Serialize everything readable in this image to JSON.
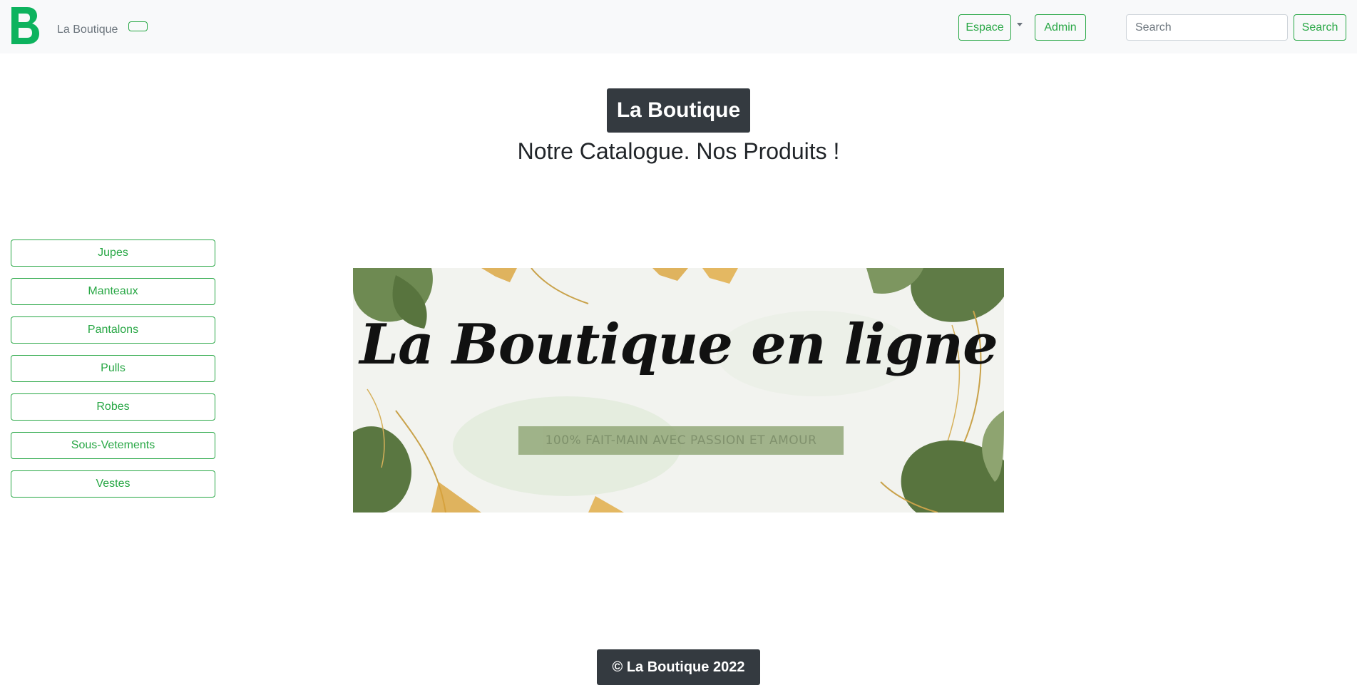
{
  "navbar": {
    "brand_logo_letter": "B",
    "brand_name": "La Boutique",
    "espace_label": "Espace",
    "admin_label": "Admin",
    "search_placeholder": "Search",
    "search_button_label": "Search"
  },
  "header": {
    "title": "La Boutique",
    "subtitle": "Notre Catalogue. Nos Produits !"
  },
  "sidebar": {
    "categories": [
      {
        "label": "Jupes"
      },
      {
        "label": "Manteaux"
      },
      {
        "label": "Pantalons"
      },
      {
        "label": "Pulls"
      },
      {
        "label": "Robes"
      },
      {
        "label": "Sous-Vetements"
      },
      {
        "label": "Vestes"
      }
    ]
  },
  "banner": {
    "headline": "La Boutique en ligne",
    "tagline": "100% FAIT-MAIN AVEC PASSION ET AMOUR"
  },
  "footer": {
    "copyright": "© La Boutique 2022"
  },
  "colors": {
    "accent": "#28a745",
    "dark": "#343a40",
    "navbar_bg": "#f8f9fa"
  }
}
